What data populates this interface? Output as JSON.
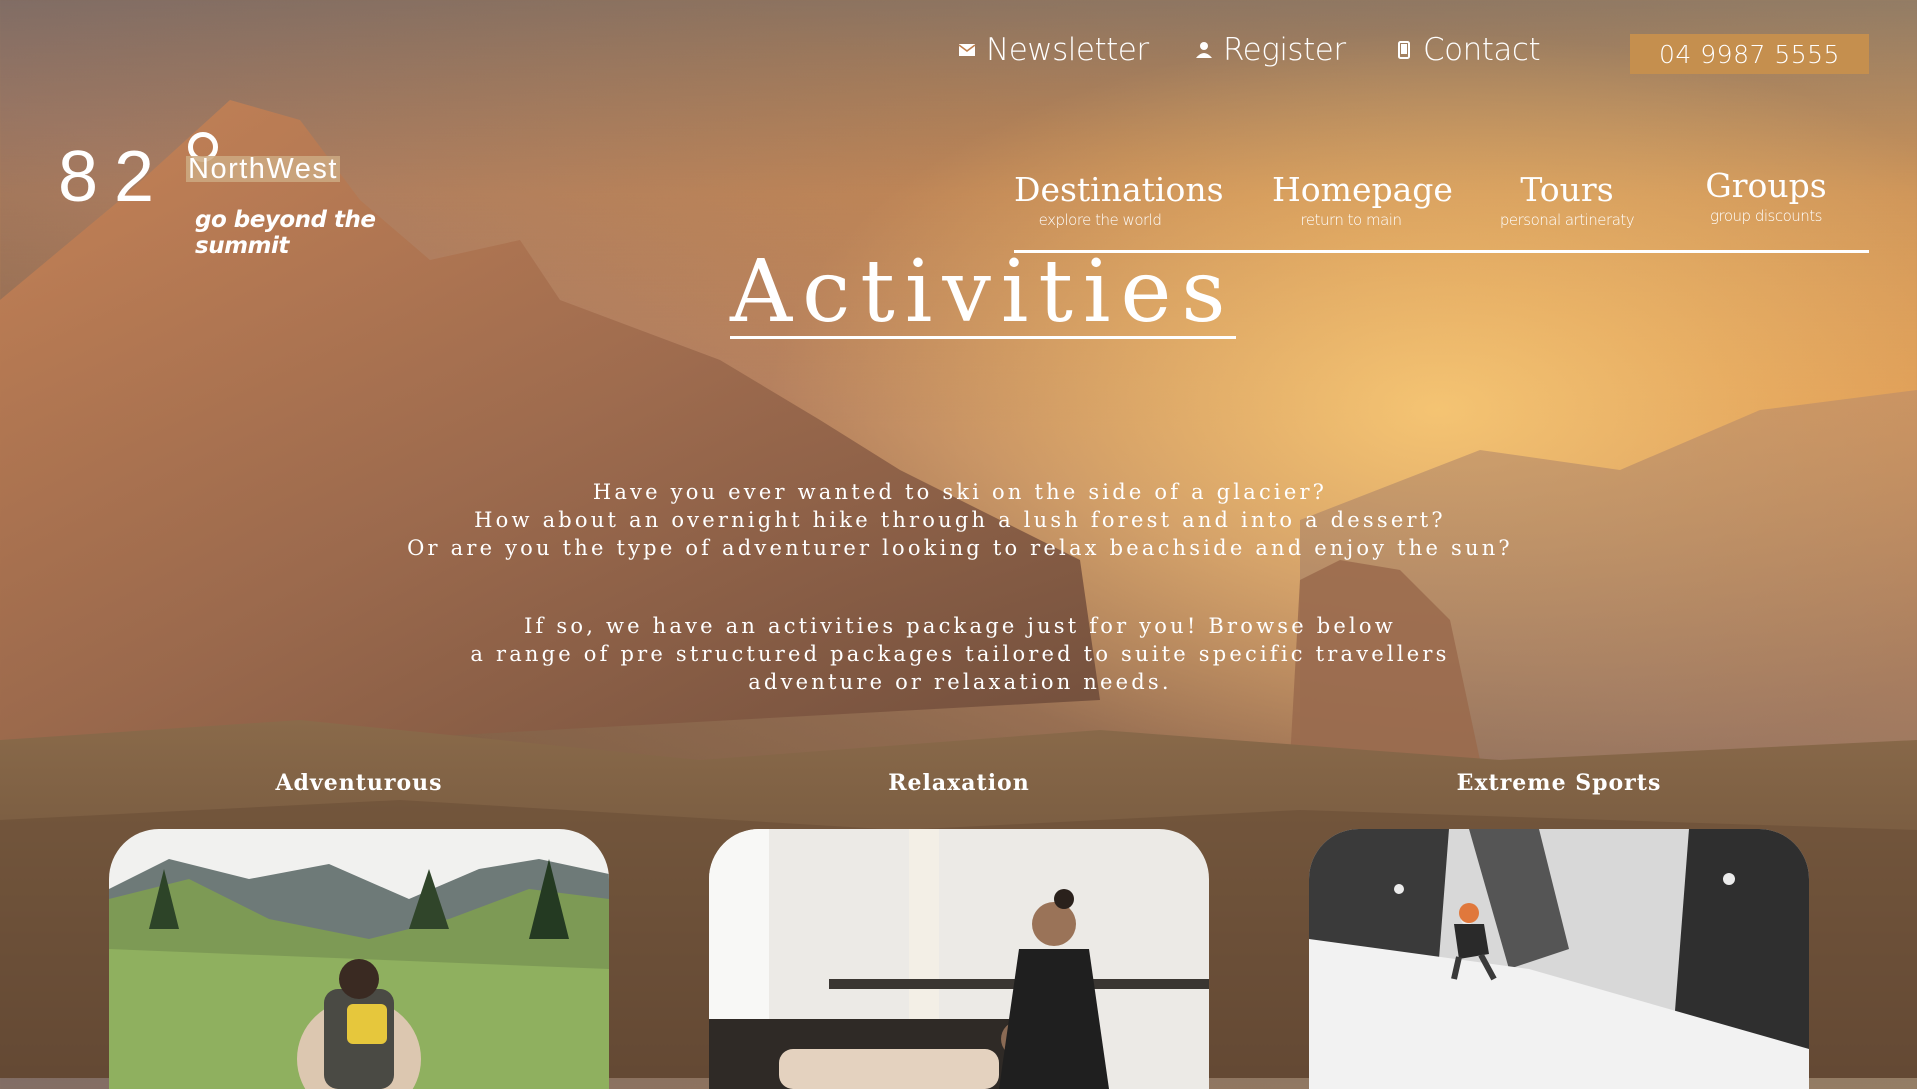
{
  "top_links": [
    {
      "label": "Newsletter",
      "icon": "envelope-icon"
    },
    {
      "label": "Register",
      "icon": "person-icon"
    },
    {
      "label": "Contact",
      "icon": "phone-icon"
    }
  ],
  "phone": "04 9987 5555",
  "logo": {
    "number": "82",
    "name": "NorthWest",
    "tagline": "go beyond the summit"
  },
  "nav": [
    {
      "title": "Destinations",
      "subtitle": "explore the world"
    },
    {
      "title": "Homepage",
      "subtitle": "return to main"
    },
    {
      "title": "Tours",
      "subtitle": "personal artineraty"
    },
    {
      "title": "Groups",
      "subtitle": "group discounts"
    }
  ],
  "page_title": "Activities",
  "intro_lines": [
    "Have you ever wanted to ski on the side of a glacier?",
    "How about an overnight hike through a lush forest and into a dessert?",
    "Or are you the type of adventurer looking to relax beachside and enjoy the sun?"
  ],
  "package_lines": [
    "If so, we have an activities package just for you! Browse below",
    "a range of pre structured packages tailored to suite specific travellers",
    "adventure or relaxation needs."
  ],
  "categories": [
    {
      "label": "Adventurous"
    },
    {
      "label": "Relaxation"
    },
    {
      "label": "Extreme Sports"
    }
  ],
  "colors": {
    "accent": "#c58f4e",
    "text": "#ffffff"
  }
}
